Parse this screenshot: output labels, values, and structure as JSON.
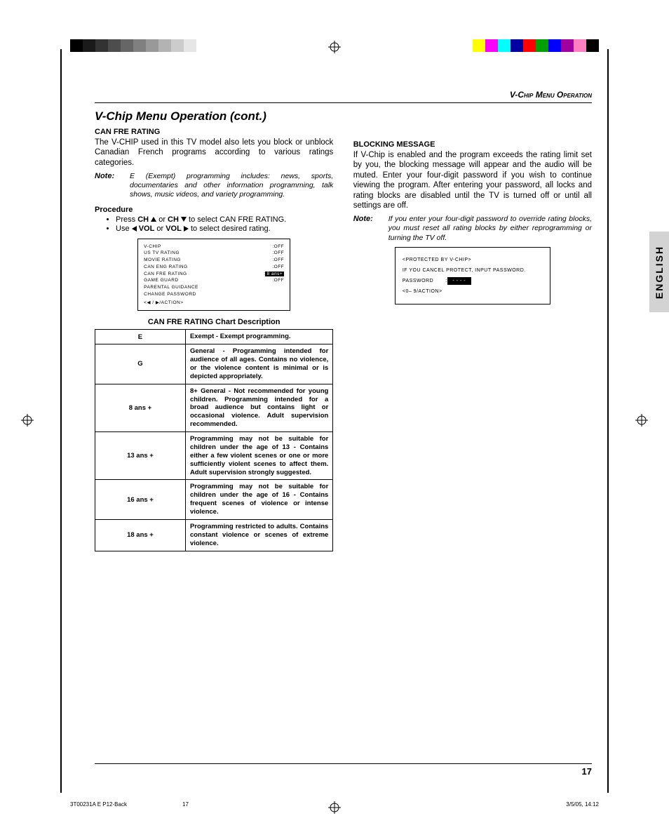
{
  "header": "V-Chip Menu Operation",
  "title": "V-Chip Menu Operation (cont.)",
  "left": {
    "sec1_title": "CAN FRE RATING",
    "sec1_body": "The V-CHIP used in this TV model also lets you block or unblock Canadian French programs according to various ratings categories.",
    "note_label": "Note:",
    "note_text": "E (Exempt) programming includes: news, sports, documentaries and other information programming, talk shows, music videos, and variety programming.",
    "proc_title": "Procedure",
    "proc": [
      {
        "pre": "Press ",
        "b1": "CH",
        "mid": " or ",
        "b2": "CH",
        "post": " to select CAN FRE RATING."
      },
      {
        "pre": "Use ",
        "b1": "VOL",
        "mid": " or ",
        "b2": "VOL",
        "post": " to select desired rating."
      }
    ],
    "osd": {
      "rows": [
        {
          "l": "V-CHIP",
          "r": ":OFF"
        },
        {
          "l": "US TV RATING",
          "r": ":OFF"
        },
        {
          "l": "MOVIE RATING",
          "r": ":OFF"
        },
        {
          "l": "CAN ENG RATING",
          "r": ":OFF"
        },
        {
          "l": "CAN FRE RATING",
          "r": "8 ans+",
          "hl": true
        },
        {
          "l": "GAME GUARD",
          "r": ":OFF"
        },
        {
          "l": "PARENTAL GUIDANCE",
          "r": ""
        },
        {
          "l": "CHANGE PASSWORD",
          "r": ""
        }
      ],
      "footer": "◀ / ▶/ACTION"
    },
    "chart_caption": "CAN FRE RATING Chart Description",
    "ratings": [
      {
        "code": "E",
        "desc": "Exempt - Exempt programming."
      },
      {
        "code": "G",
        "desc": "General - Programming intended for audience of all ages. Contains no violence, or the violence content is minimal or is depicted appropriately."
      },
      {
        "code": "8 ans +",
        "desc": "8+ General - Not recommended for young children. Programming intended for a broad audience but contains light or occasional violence. Adult supervision recommended."
      },
      {
        "code": "13 ans +",
        "desc": "Programming may not be suitable for children under the age of 13 - Contains either a few violent scenes or one or more sufficiently violent scenes to affect them. Adult supervision strongly suggested."
      },
      {
        "code": "16 ans +",
        "desc": "Programming may not be suitable for children under the age of 16 - Contains frequent scenes of violence or intense violence."
      },
      {
        "code": "18 ans +",
        "desc": "Programming restricted to adults. Contains constant violence or scenes of extreme violence."
      }
    ]
  },
  "right": {
    "sec_title": "BLOCKING MESSAGE",
    "sec_body": "If V-Chip is enabled and the program exceeds the rating limit set by you, the blocking message will appear and the audio will be muted. Enter your four-digit password if you wish to continue viewing the program. After entering your password, all locks and rating blocks are disabled until the TV is turned off or until all settings are off.",
    "note_label": "Note:",
    "note_text": "If you enter your four-digit password to override rating blocks, you must reset all rating blocks by either reprogramming or turning the TV off.",
    "osd": {
      "title": "PROTECTED BY V-CHIP",
      "msg": "IF YOU CANCEL PROTECT, INPUT PASSWORD.",
      "pw_label": "PASSWORD",
      "pw_val": "- - - -",
      "hint": "0– 9/ACTION"
    }
  },
  "lang_tab": "ENGLISH",
  "page_num": "17",
  "footer": {
    "left": "3T00231A  E P12-Back",
    "mid": "17",
    "right": "3/5/05, 14:12"
  }
}
